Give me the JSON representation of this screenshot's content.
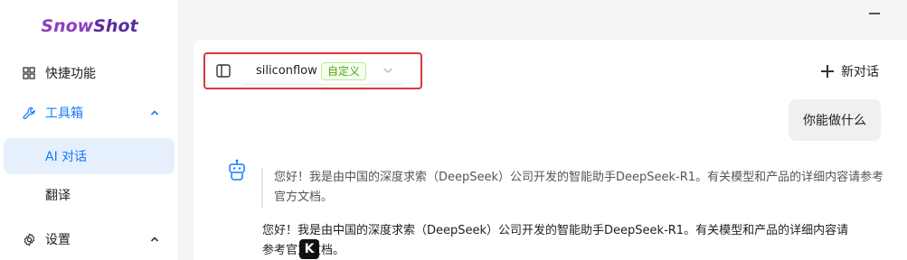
{
  "app": {
    "logo_part1": "Snow",
    "logo_part2": "Shot"
  },
  "sidebar": {
    "items": [
      {
        "label": "快捷功能",
        "icon": "grid-icon"
      },
      {
        "label": "工具箱",
        "icon": "wrench-icon",
        "expanded": true
      },
      {
        "label": "AI 对话",
        "selected": true
      },
      {
        "label": "翻译"
      },
      {
        "label": "设置",
        "icon": "gear-icon",
        "expanded": true
      }
    ]
  },
  "chat": {
    "model_name": "siliconflow",
    "model_tag": "自定义",
    "new_chat_label": "新对话",
    "user_message": "你能做什么",
    "thinking_text": "您好！我是由中国的深度求索（DeepSeek）公司开发的智能助手DeepSeek-R1。有关模型和产品的详细内容请参考官方文档。",
    "answer_text_line1": "您好！我是由中国的深度求索（DeepSeek）公司开发的智能助手DeepSeek-R1。有关模型和产品的详细内容请",
    "answer_text_line2": "参考官方文档。",
    "floating_badge": "K"
  },
  "colors": {
    "accent": "#1677ff",
    "highlight_border": "#d63a3a",
    "tag_green": "#52a31a"
  }
}
